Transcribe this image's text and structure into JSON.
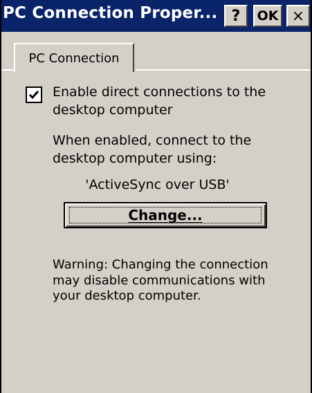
{
  "window": {
    "title": "PC Connection Proper...",
    "help_label": "?",
    "ok_label": "OK",
    "close_label": "×"
  },
  "tabs": [
    {
      "label": "PC Connection",
      "selected": true
    }
  ],
  "content": {
    "checkbox": {
      "checked": true,
      "label": "Enable direct connections to the desktop computer"
    },
    "info_text": "When enabled, connect to the desktop computer using:",
    "connection_value": "'ActiveSync over USB'",
    "change_button_label": "Change...",
    "warning_text": "Warning: Changing the connection may disable communications with your desktop computer."
  },
  "colors": {
    "titlebar": "#0a246a",
    "face": "#d4d0c8"
  }
}
